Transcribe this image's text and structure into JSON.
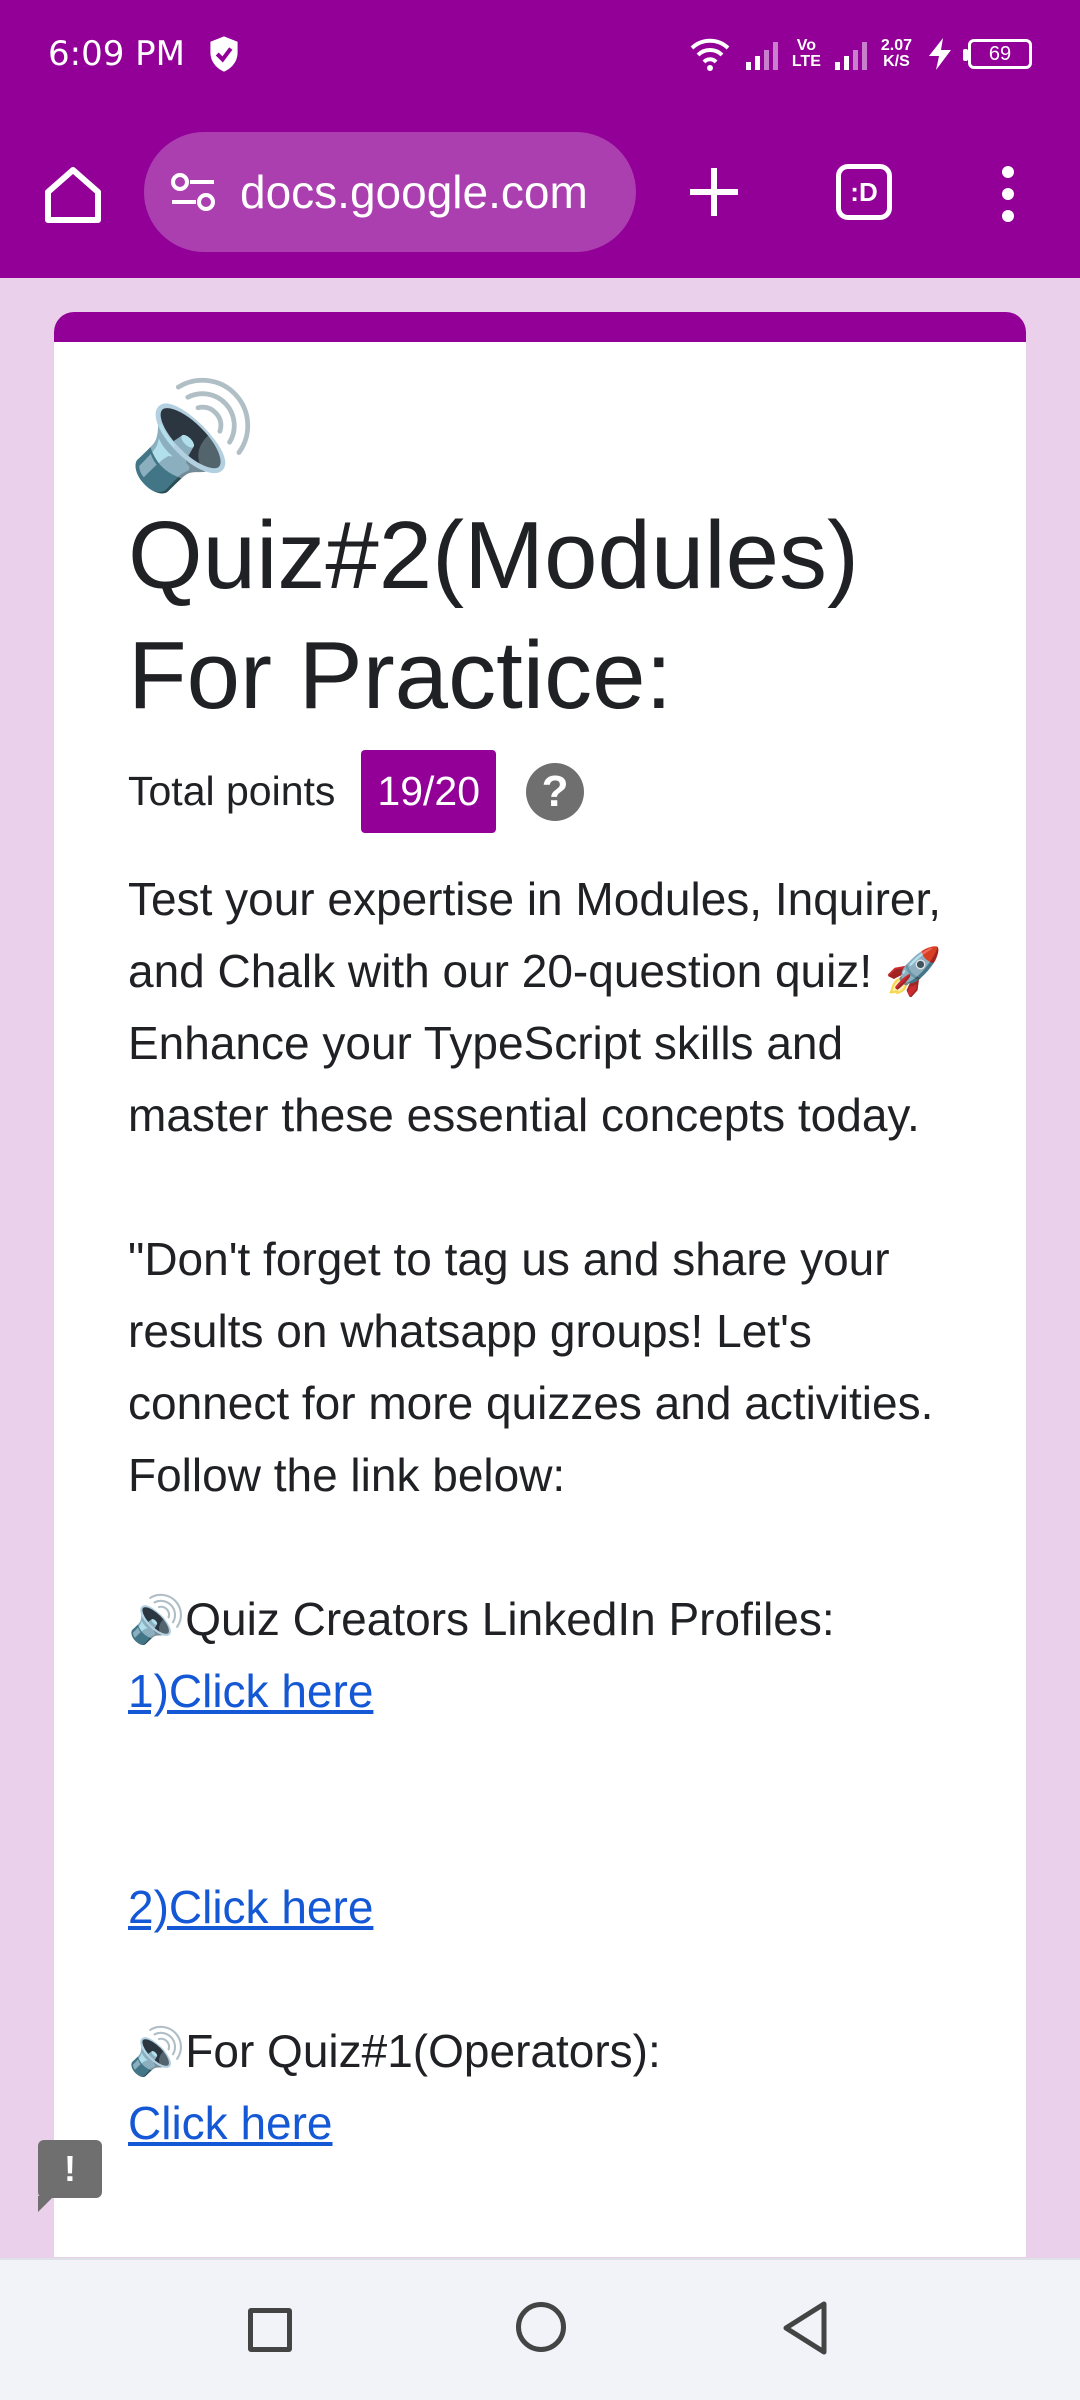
{
  "status_bar": {
    "time": "6:09 PM",
    "network_speed_value": "2.07",
    "network_speed_unit": "K/S",
    "volte_top": "Vo",
    "volte_bottom": "LTE",
    "battery": "69"
  },
  "browser": {
    "url": "docs.google.com",
    "tabs_label": ":D"
  },
  "form": {
    "header_emoji": "🔊",
    "title": "Quiz#2(Modules) For Practice:",
    "points_label": "Total points",
    "points_value": "19/20",
    "help_symbol": "?",
    "description": {
      "para1": " Test your expertise in Modules, Inquirer, and Chalk with our 20-question quiz! 🚀 Enhance your TypeScript skills and master these essential concepts today.",
      "para2": "\"Don't forget to tag us and share your results on whatsapp groups! Let's connect for more quizzes and activities. Follow the link below:",
      "linkedin_heading": "🔊Quiz Creators LinkedIn Profiles:",
      "link1": "1)Click here",
      "link2": "2)Click here",
      "quiz1_heading": "🔊For Quiz#1(Operators):",
      "link3": "Click here"
    }
  },
  "feedback_symbol": "!"
}
